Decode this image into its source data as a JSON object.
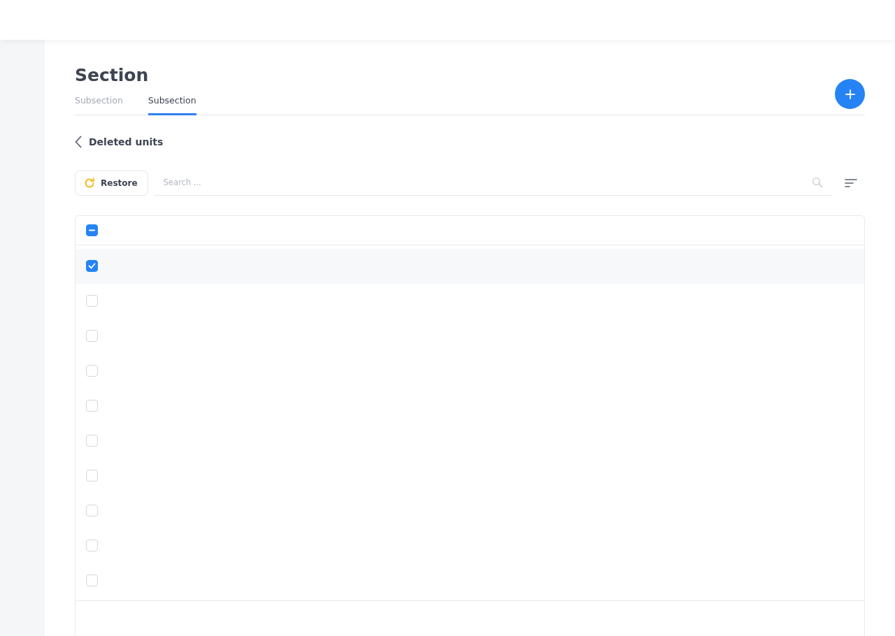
{
  "page_title": "Section",
  "tabs": [
    {
      "label": "Subsection",
      "selected": false
    },
    {
      "label": "Subsection",
      "selected": true
    }
  ],
  "back_title": "Deleted units",
  "toolbar": {
    "restore_label": "Restore",
    "search": {
      "placeholder": "Search ..."
    }
  },
  "table": {
    "header_checkbox": {
      "indeterminate": true
    },
    "rows": [
      {
        "checked": true
      },
      {
        "checked": false
      },
      {
        "checked": false
      },
      {
        "checked": false
      },
      {
        "checked": false
      },
      {
        "checked": false
      },
      {
        "checked": false
      },
      {
        "checked": false
      },
      {
        "checked": false
      },
      {
        "checked": false
      }
    ]
  }
}
